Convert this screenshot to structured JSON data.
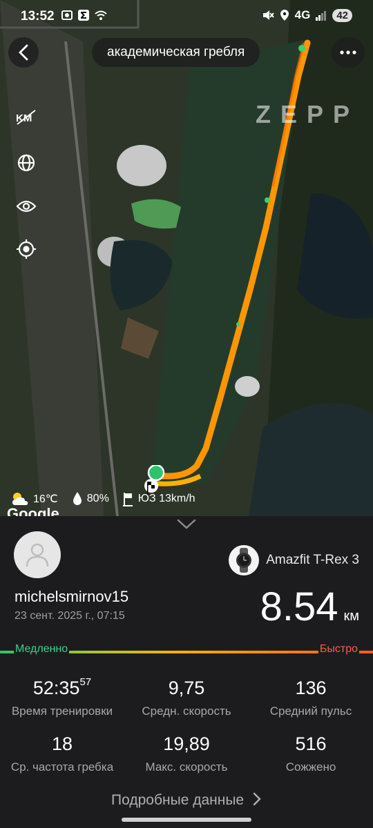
{
  "status_bar": {
    "time": "13:52",
    "network": "4G",
    "battery": "42"
  },
  "header": {
    "title": "академическая гребля"
  },
  "map": {
    "watermark": "ZEPP",
    "google_logo": "Google",
    "weather": {
      "temperature": "16℃",
      "humidity": "80%",
      "wind": "ЮЗ 13km/h"
    }
  },
  "workout": {
    "username": "michelsmirnov15",
    "date": "23 сент. 2025 г., 07:15",
    "device": "Amazfit T-Rex 3",
    "distance_value": "8.54",
    "distance_unit": "км",
    "speed_slow_label": "Медленно",
    "speed_fast_label": "Быстро",
    "stats": [
      {
        "value": "52:35",
        "value_sup": "57",
        "label": "Время тренировки"
      },
      {
        "value": "9,75",
        "label": "Средн. скорость"
      },
      {
        "value": "136",
        "label": "Средний пульс"
      },
      {
        "value": "18",
        "label": "Ср. частота гребка"
      },
      {
        "value": "19,89",
        "label": "Макс. скорость"
      },
      {
        "value": "516",
        "label": "Сожжено"
      }
    ],
    "details_link": "Подробные данные"
  },
  "colors": {
    "slow": "#3fcf8e",
    "fast": "#ff5a4a",
    "track": "#ff9a00",
    "background": "#1c1c1e"
  }
}
